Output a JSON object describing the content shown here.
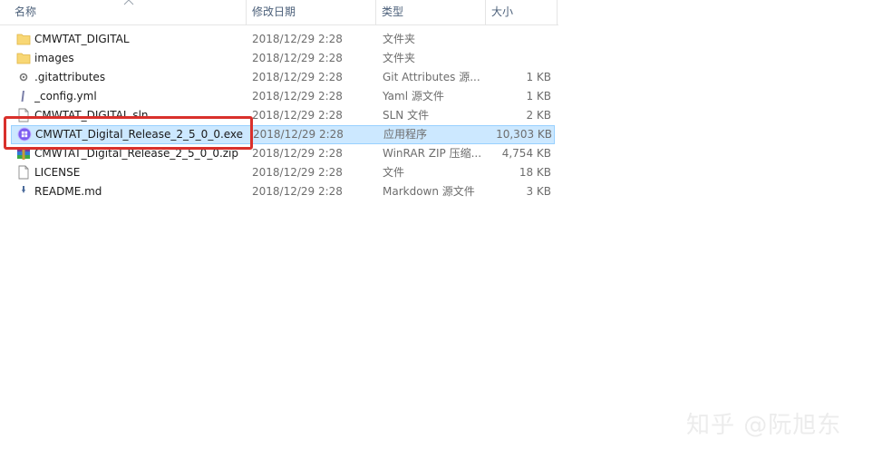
{
  "columns": {
    "name": "名称",
    "date_modified": "修改日期",
    "type": "类型",
    "size": "大小"
  },
  "files": [
    {
      "name": "CMWTAT_DIGITAL",
      "date": "2018/12/29 2:28",
      "type": "文件夹",
      "size": "",
      "icon": "folder-icon"
    },
    {
      "name": "images",
      "date": "2018/12/29 2:28",
      "type": "文件夹",
      "size": "",
      "icon": "folder-icon"
    },
    {
      "name": ".gitattributes",
      "date": "2018/12/29 2:28",
      "type": "Git Attributes 源...",
      "size": "1 KB",
      "icon": "gear-file-icon"
    },
    {
      "name": "_config.yml",
      "date": "2018/12/29 2:28",
      "type": "Yaml 源文件",
      "size": "1 KB",
      "icon": "script-file-icon"
    },
    {
      "name": "CMWTAT_DIGITAL.sln",
      "date": "2018/12/29 2:28",
      "type": "SLN 文件",
      "size": "2 KB",
      "icon": "blank-file-icon"
    },
    {
      "name": "CMWTAT_Digital_Release_2_5_0_0.exe",
      "date": "2018/12/29 2:28",
      "type": "应用程序",
      "size": "10,303 KB",
      "icon": "exe-app-icon"
    },
    {
      "name": "CMWTAT_Digital_Release_2_5_0_0.zip",
      "date": "2018/12/29 2:28",
      "type": "WinRAR ZIP 压缩...",
      "size": "4,754 KB",
      "icon": "winrar-archive-icon"
    },
    {
      "name": "LICENSE",
      "date": "2018/12/29 2:28",
      "type": "文件",
      "size": "18 KB",
      "icon": "blank-file-icon"
    },
    {
      "name": "README.md",
      "date": "2018/12/29 2:28",
      "type": "Markdown 源文件",
      "size": "3 KB",
      "icon": "markdown-file-icon"
    }
  ],
  "selected_file": "CMWTAT_Digital_Release_2_5_0_0.exe",
  "watermark": "知乎 @阮旭东",
  "colors": {
    "selection_bg": "#cce8ff",
    "selection_border": "#99d1ff",
    "highlight_box": "#d9302b",
    "folder": "#f8d775"
  }
}
